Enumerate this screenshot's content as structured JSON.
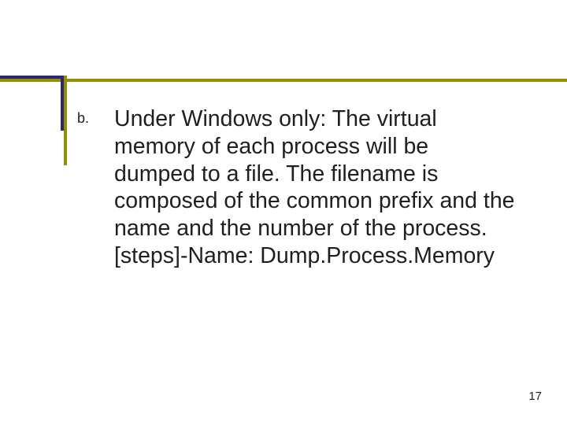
{
  "content": {
    "marker": "b.",
    "paragraph1": "Under Windows only: The virtual memory of each process will be dumped to a file. The filename is composed of the common prefix and the name and the number of the process.",
    "paragraph2": "[steps]-Name: Dump.Process.Memory",
    "page_number": "17"
  }
}
